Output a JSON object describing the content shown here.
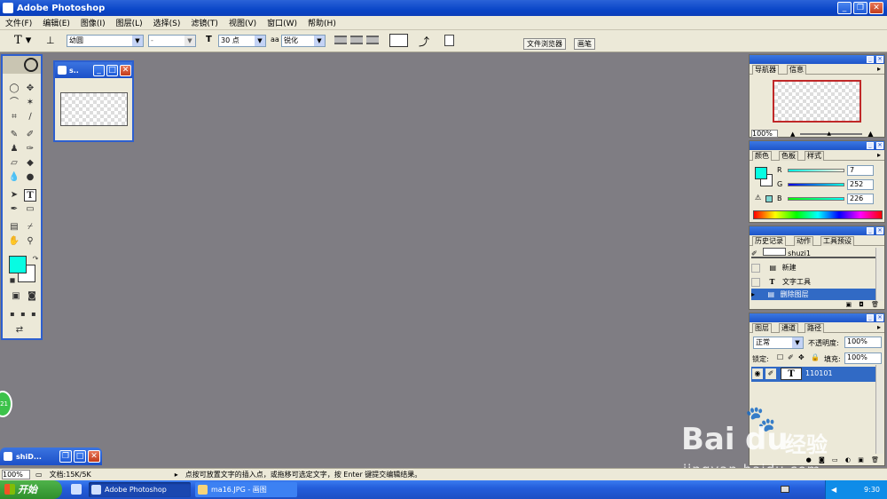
{
  "app": {
    "title": "Adobe Photoshop"
  },
  "menu": [
    "文件(F)",
    "编辑(E)",
    "图像(I)",
    "图层(L)",
    "选择(S)",
    "滤镜(T)",
    "视图(V)",
    "窗口(W)",
    "帮助(H)"
  ],
  "options": {
    "font_family": "幼圆",
    "font_style": "-",
    "font_size": "30 点",
    "antialias_label": "aa",
    "antialias": "锐化",
    "tab_file_browser": "文件浏览器",
    "tab_brushes": "画笔"
  },
  "document": {
    "title": "s.."
  },
  "navigator": {
    "tabs": [
      "导航器",
      "信息"
    ],
    "zoom": "100%"
  },
  "color": {
    "tabs": [
      "颜色",
      "色板",
      "样式"
    ],
    "r_label": "R",
    "r": "7",
    "g_label": "G",
    "g": "252",
    "b_label": "B",
    "b": "226",
    "foreground": "#07fce2"
  },
  "history": {
    "tabs": [
      "历史记录",
      "动作",
      "工具预设"
    ],
    "snapshot": "shuzi1",
    "items": [
      "新建",
      "文字工具",
      "删除图层"
    ]
  },
  "layers": {
    "tabs": [
      "图层",
      "通道",
      "路径"
    ],
    "blend_mode": "正常",
    "opacity_label": "不透明度:",
    "opacity": "100%",
    "lock_label": "锁定:",
    "fill_label": "填充:",
    "fill": "100%",
    "layer_name": "110101"
  },
  "status": {
    "zoom": "100%",
    "doc_info": "文档:15K/5K",
    "hint": "点按可放置文字的插入点，或拖移可选定文字，按 Enter 键提交编辑结果。"
  },
  "minimized": {
    "title": "shiD..."
  },
  "taskbar": {
    "start": "开始",
    "items": [
      "Adobe Photoshop",
      "ma16.JPG - 画图"
    ],
    "time": "9:30"
  },
  "watermark": {
    "brand": "Bai",
    "brand2": "du",
    "sub": "经验",
    "url": "jingyan.baidu.com"
  },
  "side_badge": "21"
}
